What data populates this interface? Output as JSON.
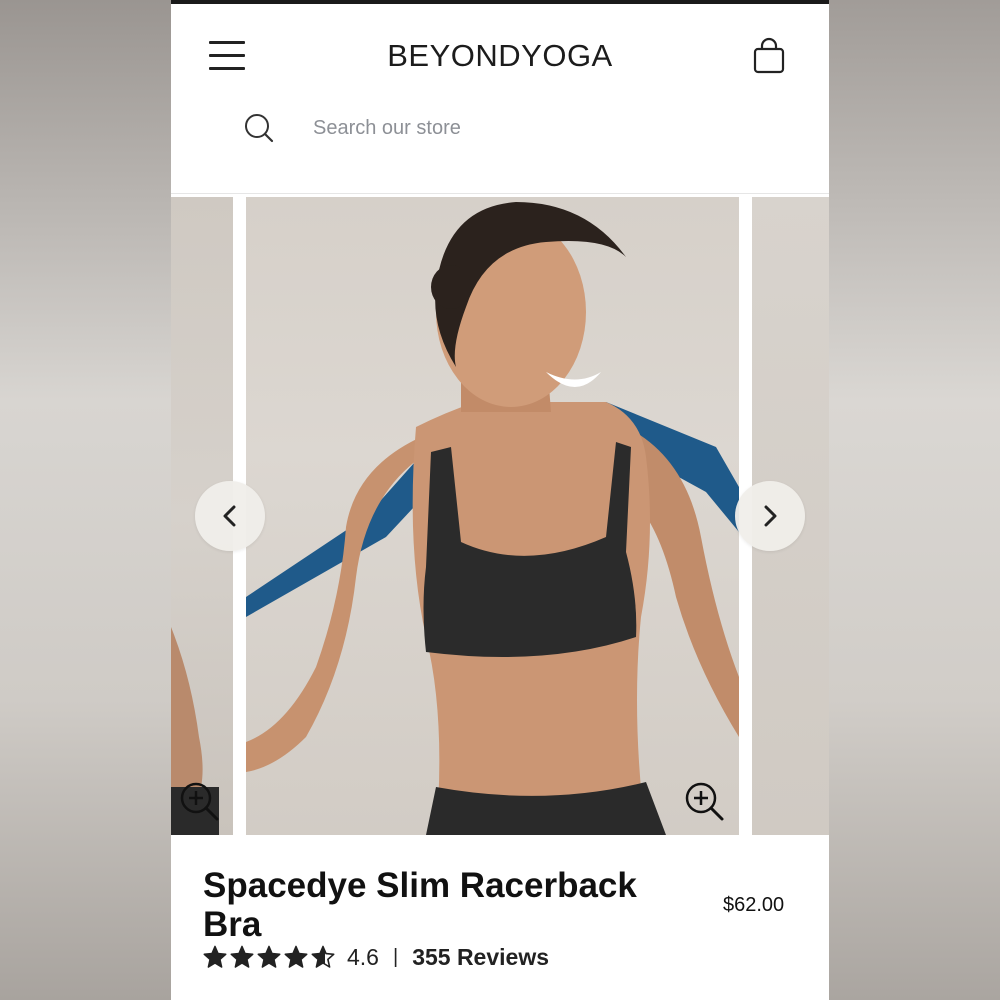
{
  "header": {
    "logo_primary": "BEYOND",
    "logo_secondary": "YOGA"
  },
  "search": {
    "placeholder": "Search our store"
  },
  "product": {
    "title": "Spacedye Slim Racerback Bra",
    "price": "$62.00",
    "rating_value": "4.6",
    "rating_stars": 4.6,
    "separator": "|",
    "reviews_label": "355 Reviews"
  },
  "icons": {
    "menu": "hamburger-icon",
    "cart": "shopping-bag-icon",
    "search": "search-icon",
    "prev": "chevron-left-icon",
    "next": "chevron-right-icon",
    "zoom": "zoom-in-icon",
    "star": "star-icon"
  },
  "colors": {
    "text": "#111111",
    "placeholder": "#8d9096",
    "background": "#ffffff"
  }
}
